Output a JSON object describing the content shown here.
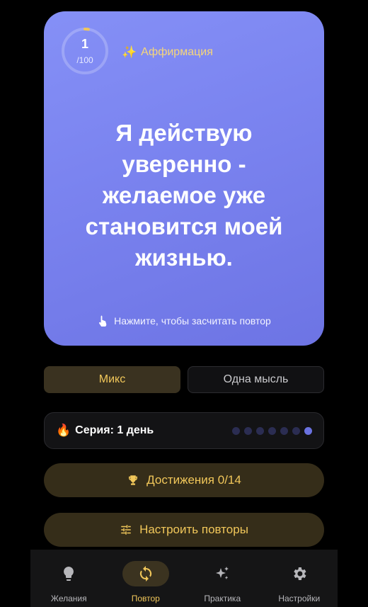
{
  "card": {
    "counter_value": "1",
    "counter_total": "/100",
    "progress": 0.01,
    "label": "Аффирмация",
    "label_icon": "sparkles-icon",
    "affirmation": "Я действую уверенно - желаемое уже становится моей жизнью.",
    "hint": "Нажмите, чтобы засчитать повтор",
    "hint_icon": "tap-hand-icon"
  },
  "modes": {
    "mix": "Микс",
    "one_thought": "Одна мысль",
    "selected": "mix"
  },
  "streak": {
    "icon": "fire-icon",
    "label": "Серия: 1 день",
    "days_total": 7,
    "days_active": 1
  },
  "actions": {
    "achievements": "Достижения 0/14",
    "configure": "Настроить повторы"
  },
  "nav": {
    "items": [
      {
        "label": "Желания",
        "icon": "lightbulb-icon"
      },
      {
        "label": "Повтор",
        "icon": "repeat-icon",
        "active": true
      },
      {
        "label": "Практика",
        "icon": "sparkle-icon"
      },
      {
        "label": "Настройки",
        "icon": "gear-icon"
      }
    ]
  },
  "colors": {
    "accent": "#f1c75a",
    "card": "#7b84f0",
    "background": "#000000"
  }
}
